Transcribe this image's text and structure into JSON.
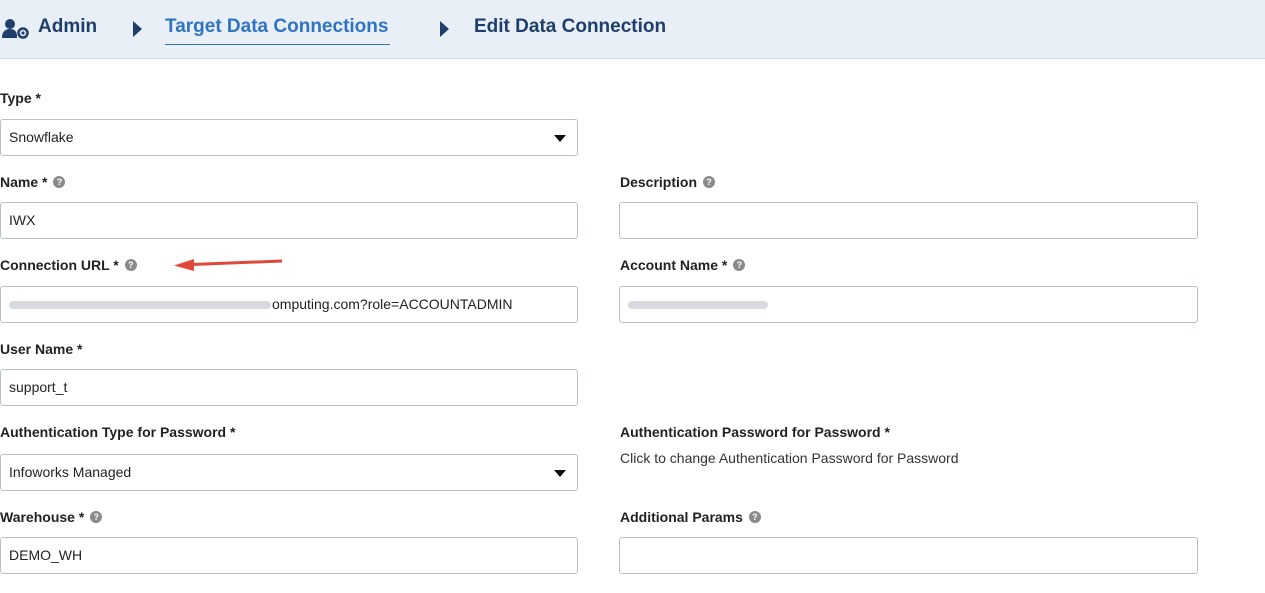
{
  "breadcrumb": {
    "items": [
      "Admin",
      "Target Data Connections",
      "Edit Data Connection"
    ]
  },
  "form": {
    "type": {
      "label": "Type *",
      "value": "Snowflake"
    },
    "name": {
      "label": "Name *",
      "value": "IWX"
    },
    "description": {
      "label": "Description",
      "value": ""
    },
    "connection_url": {
      "label": "Connection URL *",
      "value_visible": "omputing.com?role=ACCOUNTADMIN"
    },
    "account_name": {
      "label": "Account Name *"
    },
    "user_name": {
      "label": "User Name *",
      "value": "support_t"
    },
    "auth_type": {
      "label": "Authentication Type for Password *",
      "value": "Infoworks Managed"
    },
    "auth_password": {
      "label": "Authentication Password for Password *",
      "link_text": "Click to change Authentication Password for Password"
    },
    "warehouse": {
      "label": "Warehouse *",
      "value": "DEMO_WH"
    },
    "additional_params": {
      "label": "Additional Params",
      "value": ""
    }
  },
  "colors": {
    "accent": "#2f74c0",
    "nav_text": "#1f3f6b",
    "annotation_arrow": "#e0493a"
  }
}
